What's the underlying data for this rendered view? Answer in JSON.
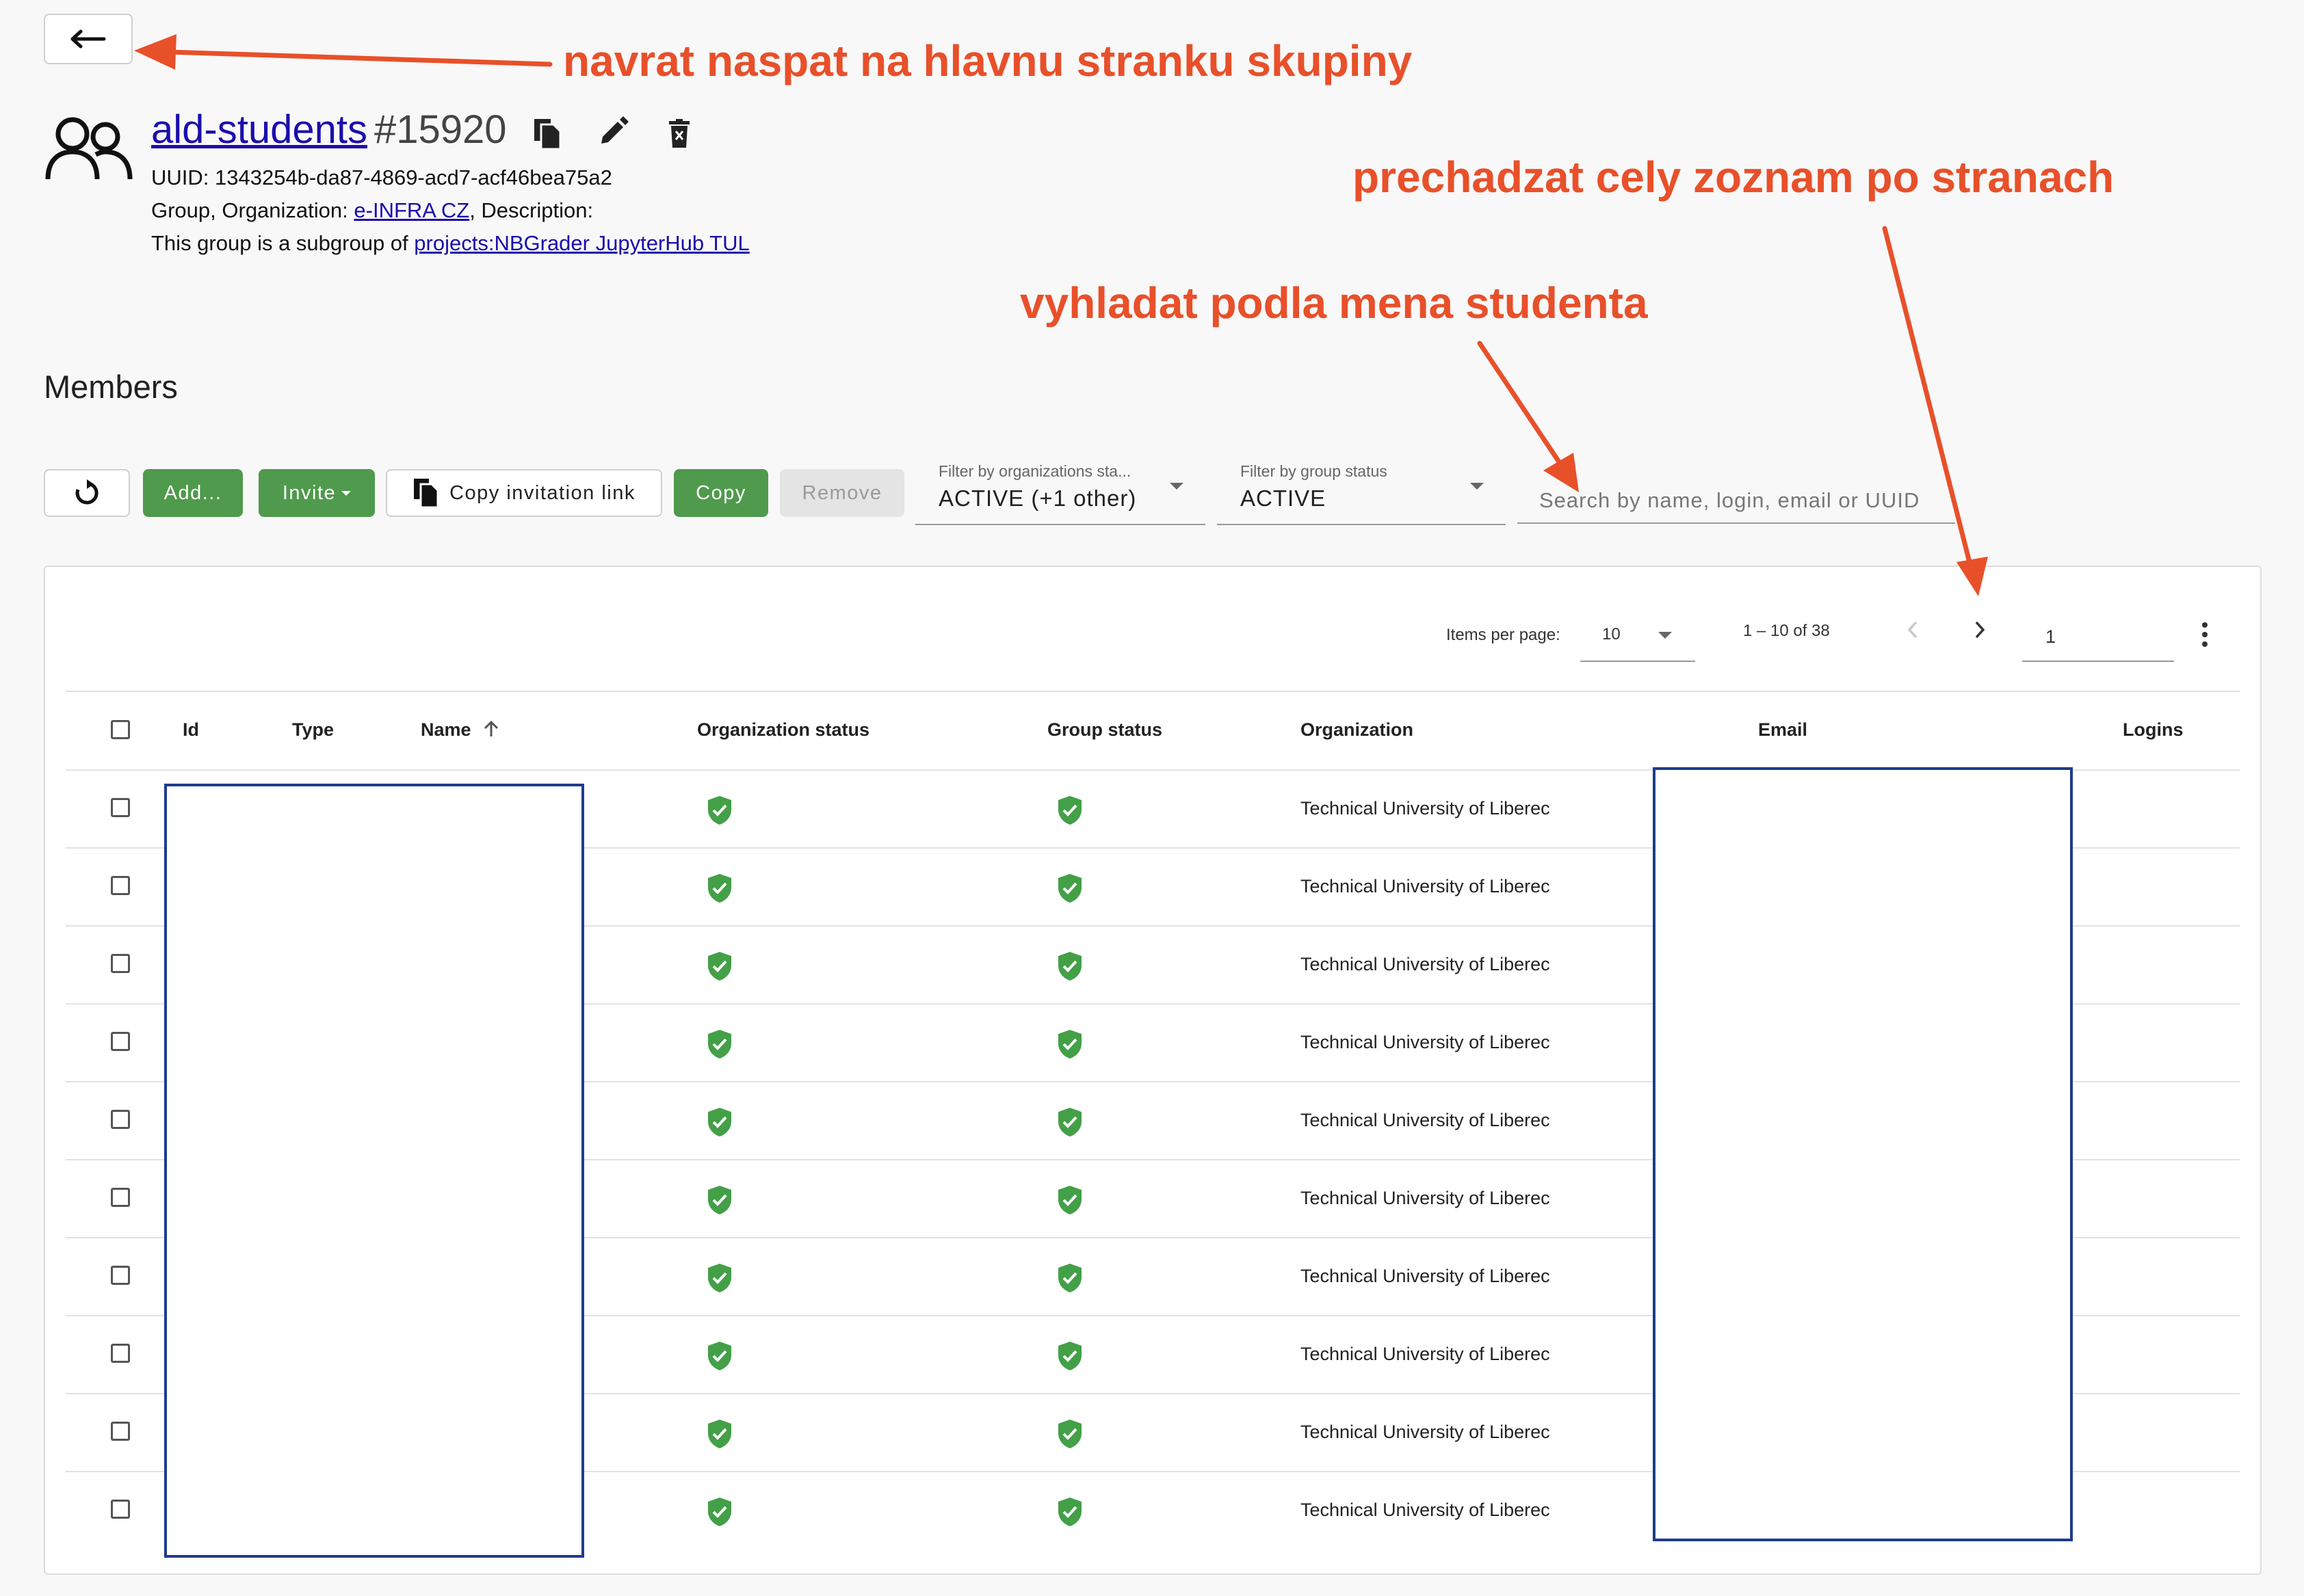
{
  "annotations": {
    "back": "navrat naspat na hlavnu stranku skupiny",
    "paging": "prechadzat cely zoznam po stranach",
    "search": "vyhladat podla mena studenta",
    "color": "#e8502a"
  },
  "group": {
    "name": "ald-students",
    "id": "#15920",
    "uuid_line": "UUID: 1343254b-da87-4869-acd7-acf46bea75a2",
    "info_prefix": "Group, Organization: ",
    "organization": "e-INFRA CZ",
    "info_suffix": ", Description:",
    "subgroup_prefix": "This group is a subgroup of ",
    "parent": "projects:NBGrader JupyterHub TUL"
  },
  "members_heading": "Members",
  "toolbar": {
    "add_label": "Add...",
    "invite_label": "Invite",
    "copy_link_label": "Copy invitation link",
    "copy_label": "Copy",
    "remove_label": "Remove",
    "filter_org": {
      "label": "Filter by organizations sta...",
      "value": "ACTIVE (+1 other)"
    },
    "filter_group": {
      "label": "Filter by group status",
      "value": "ACTIVE"
    },
    "search_placeholder": "Search by name, login, email or UUID"
  },
  "pagination": {
    "items_per_page_label": "Items per page:",
    "items_per_page": "10",
    "range": "1 – 10 of 38",
    "page": "1"
  },
  "columns": [
    "Id",
    "Type",
    "Name",
    "Organization status",
    "Group status",
    "Organization",
    "Email",
    "Logins"
  ],
  "sort": {
    "column": "Name",
    "direction": "ascending"
  },
  "status_color": "#43a047",
  "rows": [
    {
      "organization": "Technical University of Liberec"
    },
    {
      "organization": "Technical University of Liberec"
    },
    {
      "organization": "Technical University of Liberec"
    },
    {
      "organization": "Technical University of Liberec"
    },
    {
      "organization": "Technical University of Liberec"
    },
    {
      "organization": "Technical University of Liberec"
    },
    {
      "organization": "Technical University of Liberec"
    },
    {
      "organization": "Technical University of Liberec"
    },
    {
      "organization": "Technical University of Liberec"
    },
    {
      "organization": "Technical University of Liberec"
    }
  ]
}
